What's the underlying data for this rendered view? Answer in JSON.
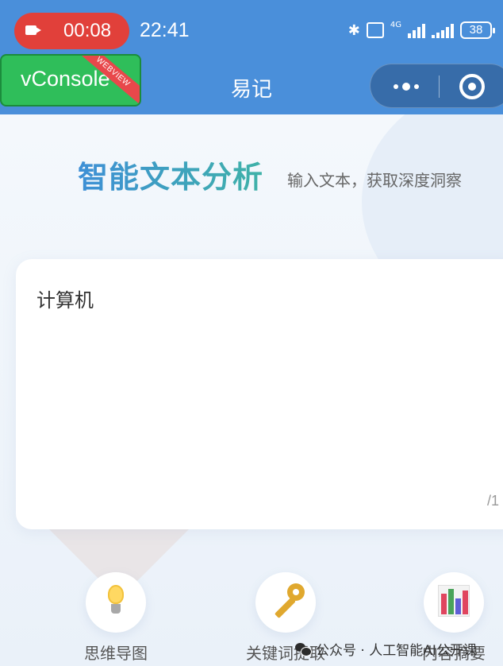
{
  "status_bar": {
    "recording_time": "00:08",
    "clock": "22:41",
    "network_label": "4G",
    "battery": "38"
  },
  "nav_bar": {
    "title": "易记",
    "vconsole_label": "vConsole",
    "vconsole_badge": "WEBVIEW"
  },
  "main": {
    "headline": "智能文本分析",
    "subline": "输入文本，获取深度洞察",
    "input_text": "计算机",
    "char_count": "/1"
  },
  "features": [
    {
      "label": "思维导图",
      "icon": "lightbulb-icon"
    },
    {
      "label": "关键词提取",
      "icon": "key-icon"
    },
    {
      "label": "内容摘要",
      "icon": "bar-chart-icon"
    }
  ],
  "watermark": {
    "text": "公众号 · 人工智能AI公开课"
  },
  "colors": {
    "nav_blue": "#4a8fda",
    "record_red": "#e1403a",
    "vconsole_green": "#2fbe5a"
  }
}
